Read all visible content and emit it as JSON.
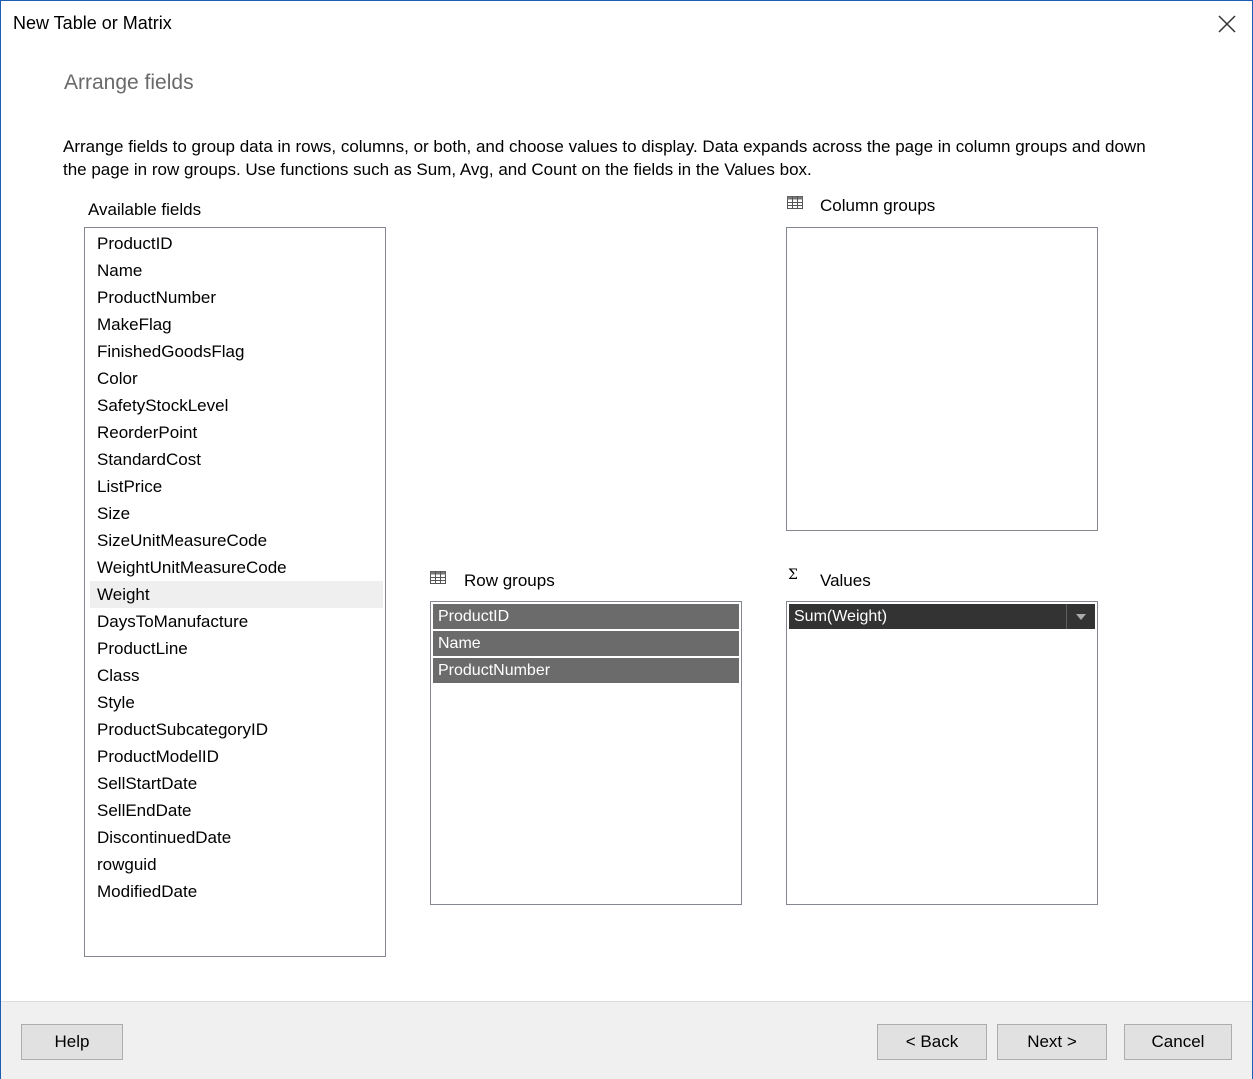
{
  "window": {
    "title": "New Table or Matrix"
  },
  "page": {
    "heading": "Arrange fields",
    "description": "Arrange fields to group data in rows, columns, or both, and choose values to display. Data expands across the page in column groups and down the page in row groups.  Use functions such as Sum, Avg, and Count on the fields in the Values box."
  },
  "available_fields": {
    "label": "Available fields",
    "items": [
      "ProductID",
      "Name",
      "ProductNumber",
      "MakeFlag",
      "FinishedGoodsFlag",
      "Color",
      "SafetyStockLevel",
      "ReorderPoint",
      "StandardCost",
      "ListPrice",
      "Size",
      "SizeUnitMeasureCode",
      "WeightUnitMeasureCode",
      "Weight",
      "DaysToManufacture",
      "ProductLine",
      "Class",
      "Style",
      "ProductSubcategoryID",
      "ProductModelID",
      "SellStartDate",
      "SellEndDate",
      "DiscontinuedDate",
      "rowguid",
      "ModifiedDate"
    ],
    "hovered_item": "Weight"
  },
  "column_groups": {
    "label": "Column groups",
    "icon": "table-grid-icon",
    "items": []
  },
  "row_groups": {
    "label": "Row groups",
    "icon": "table-grid-icon",
    "items": [
      "ProductID",
      "Name",
      "ProductNumber"
    ]
  },
  "values": {
    "label": "Values",
    "icon": "sigma-icon",
    "symbol": "Σ",
    "items": [
      "Sum(Weight)"
    ]
  },
  "buttons": {
    "help": "Help",
    "back": "< Back",
    "next": "Next >",
    "cancel": "Cancel"
  },
  "colors": {
    "window_border": "#1a5fb4",
    "heading_text": "#6a6a6a",
    "row_group_item_bg": "#6b6b6b",
    "value_item_bg": "#333333",
    "hover_bg": "#efefef",
    "footer_bg": "#f0f0f0",
    "button_bg": "#e1e1e1"
  }
}
